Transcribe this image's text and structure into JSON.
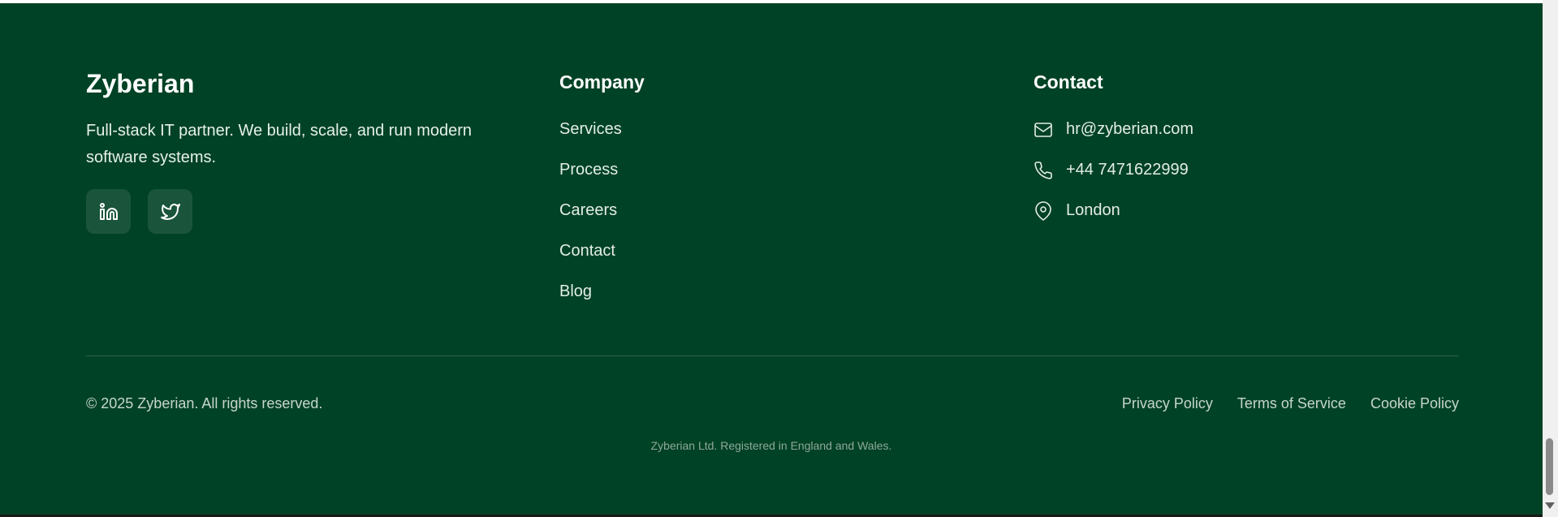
{
  "brand": {
    "name": "Zyberian",
    "description": "Full-stack IT partner. We build, scale, and run modern software systems."
  },
  "social": [
    {
      "icon": "linkedin-icon",
      "label": "in"
    },
    {
      "icon": "twitter-icon",
      "label": ""
    }
  ],
  "company": {
    "title": "Company",
    "links": [
      "Services",
      "Process",
      "Careers",
      "Contact",
      "Blog"
    ]
  },
  "contact": {
    "title": "Contact",
    "items": [
      {
        "icon": "mail-icon",
        "text": "hr@zyberian.com"
      },
      {
        "icon": "phone-icon",
        "text": "+44 7471622999"
      },
      {
        "icon": "map-pin-icon",
        "text": "London"
      }
    ]
  },
  "bottom": {
    "copyright": "© 2025 Zyberian. All rights reserved.",
    "legal_links": [
      "Privacy Policy",
      "Terms of Service",
      "Cookie Policy"
    ],
    "registration": "Zyberian Ltd. Registered in England and Wales."
  },
  "colors": {
    "footer_bg": "#004225",
    "text_primary": "#ffffff",
    "text_muted": "#c6d6cc"
  }
}
